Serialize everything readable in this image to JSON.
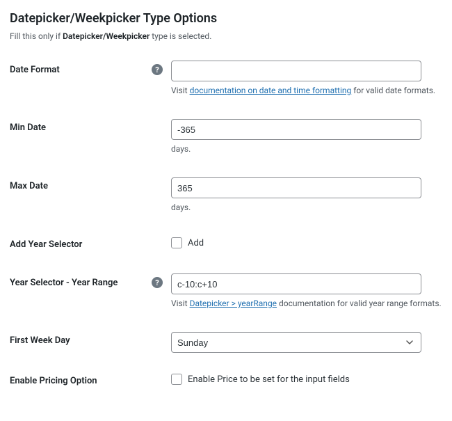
{
  "heading": "Datepicker/Weekpicker Type Options",
  "subtitle": {
    "prefix": "Fill this only if ",
    "strong": "Datepicker/Weekpicker",
    "suffix": " type is selected."
  },
  "fields": {
    "date_format": {
      "label": "Date Format",
      "value": "",
      "hint_prefix": "Visit ",
      "hint_link": "documentation on date and time formatting",
      "hint_suffix": " for valid date formats."
    },
    "min_date": {
      "label": "Min Date",
      "value": "-365",
      "hint": "days."
    },
    "max_date": {
      "label": "Max Date",
      "value": "365",
      "hint": "days."
    },
    "add_year_selector": {
      "label": "Add Year Selector",
      "checkbox_label": "Add"
    },
    "year_range": {
      "label": "Year Selector - Year Range",
      "value": "c-10:c+10",
      "hint_prefix": "Visit ",
      "hint_link": "Datepicker > yearRange",
      "hint_suffix": " documentation for valid year range formats."
    },
    "first_week_day": {
      "label": "First Week Day",
      "value": "Sunday"
    },
    "enable_pricing": {
      "label": "Enable Pricing Option",
      "checkbox_label": "Enable Price to be set for the input fields"
    }
  }
}
